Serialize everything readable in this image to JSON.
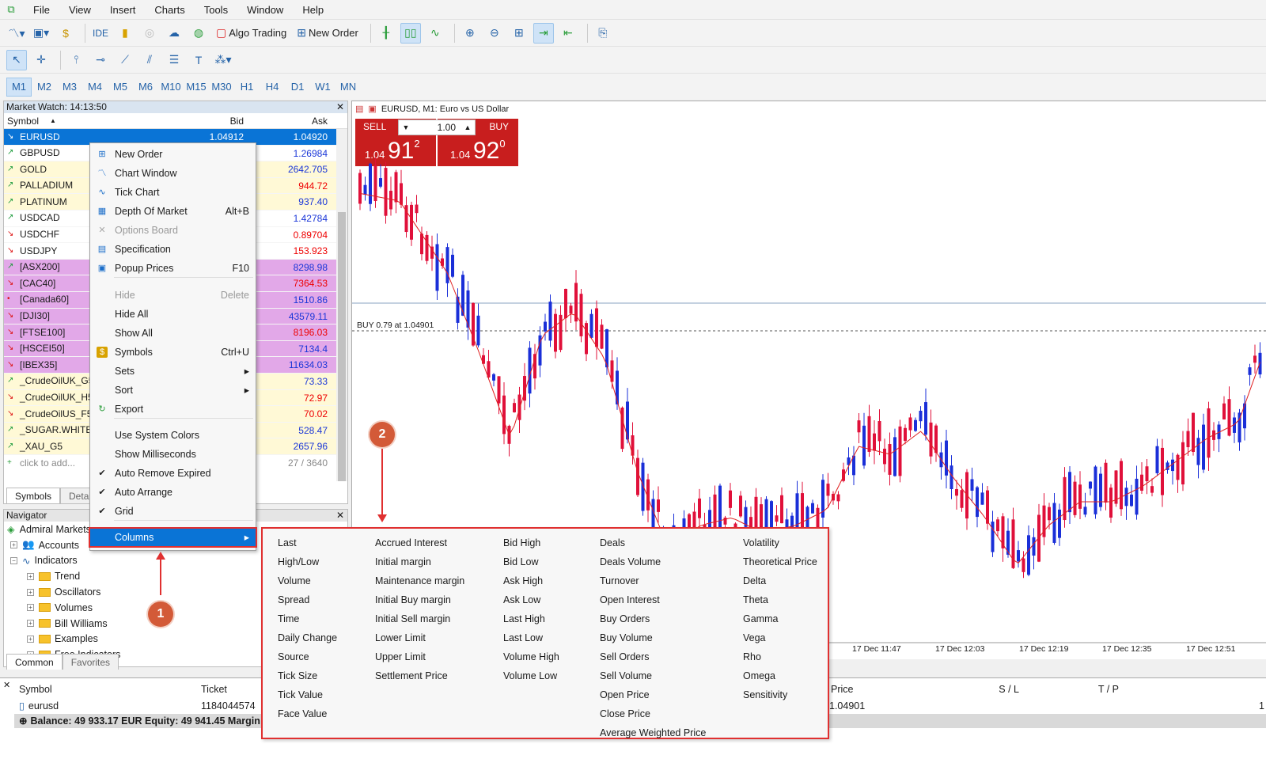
{
  "menu": [
    "File",
    "View",
    "Insert",
    "Charts",
    "Tools",
    "Window",
    "Help"
  ],
  "toolbar": {
    "ide": "IDE",
    "algo_trading": "Algo Trading",
    "new_order": "New Order"
  },
  "timeframes": [
    "M1",
    "M2",
    "M3",
    "M4",
    "M5",
    "M6",
    "M10",
    "M15",
    "M30",
    "H1",
    "H4",
    "D1",
    "W1",
    "MN"
  ],
  "market_watch": {
    "title": "Market Watch: 14:13:50",
    "col_symbol": "Symbol",
    "col_bid": "Bid",
    "col_ask": "Ask",
    "rows": [
      {
        "s": "EURUSD",
        "b": "1.04912",
        "a": "1.04920"
      },
      {
        "s": "GBPUSD",
        "b": "",
        "a": "1.26984"
      },
      {
        "s": "GOLD",
        "b": "",
        "a": "2642.705"
      },
      {
        "s": "PALLADIUM",
        "b": "",
        "a": "944.72"
      },
      {
        "s": "PLATINUM",
        "b": "",
        "a": "937.40"
      },
      {
        "s": "USDCAD",
        "b": "",
        "a": "1.42784"
      },
      {
        "s": "USDCHF",
        "b": "",
        "a": "0.89704"
      },
      {
        "s": "USDJPY",
        "b": "",
        "a": "153.923"
      },
      {
        "s": "[ASX200]",
        "b": "",
        "a": "8298.98"
      },
      {
        "s": "[CAC40]",
        "b": "",
        "a": "7364.53"
      },
      {
        "s": "[Canada60]",
        "b": "",
        "a": "1510.86"
      },
      {
        "s": "[DJI30]",
        "b": "",
        "a": "43579.11"
      },
      {
        "s": "[FTSE100]",
        "b": "",
        "a": "8196.03"
      },
      {
        "s": "[HSCEI50]",
        "b": "",
        "a": "7134.4"
      },
      {
        "s": "[IBEX35]",
        "b": "",
        "a": "11634.03"
      },
      {
        "s": "_CrudeOilUK_G5",
        "b": "",
        "a": "73.33"
      },
      {
        "s": "_CrudeOilUK_H5",
        "b": "",
        "a": "72.97"
      },
      {
        "s": "_CrudeOilUS_F5",
        "b": "",
        "a": "70.02"
      },
      {
        "s": "_SUGAR.WHITE_",
        "b": "",
        "a": "528.47"
      },
      {
        "s": "_XAU_G5",
        "b": "",
        "a": "2657.96"
      }
    ],
    "add": "click to add...",
    "count": "27 / 3640",
    "tab_symbols": "Symbols",
    "tab_details": "Details"
  },
  "navigator": {
    "title": "Navigator",
    "root": "Admiral Markets",
    "accounts": "Accounts",
    "indicators": "Indicators",
    "folders": [
      "Trend",
      "Oscillators",
      "Volumes",
      "Bill Williams",
      "Examples",
      "Free Indicators"
    ],
    "tab_common": "Common",
    "tab_favorites": "Favorites"
  },
  "chart": {
    "title": "EURUSD, M1:  Euro vs US Dollar",
    "sell": "SELL",
    "buy": "BUY",
    "volume": "1.00",
    "sell_pre": "1.04",
    "sell_big": "91",
    "sell_sup": "2",
    "buy_pre": "1.04",
    "buy_big": "92",
    "buy_sup": "0",
    "order_line": "BUY 0.79 at 1.04901",
    "time_labels": [
      "17 Dec 11:47",
      "17 Dec 12:03",
      "17 Dec 12:19",
      "17 Dec 12:35",
      "17 Dec 12:51"
    ]
  },
  "context_menu": {
    "items": [
      {
        "l": "New Order",
        "s": ""
      },
      {
        "l": "Chart Window",
        "s": ""
      },
      {
        "l": "Tick Chart",
        "s": ""
      },
      {
        "l": "Depth Of Market",
        "s": "Alt+B"
      },
      {
        "l": "Options Board",
        "s": ""
      },
      {
        "l": "Specification",
        "s": ""
      },
      {
        "l": "Popup Prices",
        "s": "F10"
      },
      {
        "l": "Hide",
        "s": "Delete"
      },
      {
        "l": "Hide All",
        "s": ""
      },
      {
        "l": "Show All",
        "s": ""
      },
      {
        "l": "Symbols",
        "s": "Ctrl+U"
      },
      {
        "l": "Sets",
        "s": ""
      },
      {
        "l": "Sort",
        "s": ""
      },
      {
        "l": "Export",
        "s": ""
      },
      {
        "l": "Use System Colors",
        "s": ""
      },
      {
        "l": "Show Milliseconds",
        "s": ""
      },
      {
        "l": "Auto Remove Expired",
        "s": ""
      },
      {
        "l": "Auto Arrange",
        "s": ""
      },
      {
        "l": "Grid",
        "s": ""
      },
      {
        "l": "Columns",
        "s": ""
      }
    ]
  },
  "columns_submenu": [
    [
      "Last",
      "High/Low",
      "Volume",
      "Spread",
      "Time",
      "Daily Change",
      "Source",
      "Tick Size",
      "Tick Value",
      "Face Value"
    ],
    [
      "Accrued Interest",
      "Initial margin",
      "Maintenance margin",
      "Initial Buy margin",
      "Initial Sell margin",
      "Lower Limit",
      "Upper Limit",
      "Settlement Price"
    ],
    [
      "Bid High",
      "Bid Low",
      "Ask High",
      "Ask Low",
      "Last High",
      "Last Low",
      "Volume High",
      "Volume Low"
    ],
    [
      "Deals",
      "Deals Volume",
      "Turnover",
      "Open Interest",
      "Buy Orders",
      "Buy Volume",
      "Sell Orders",
      "Sell Volume",
      "Open Price",
      "Close Price",
      "Average Weighted Price"
    ],
    [
      "Volatility",
      "Theoretical Price",
      "Delta",
      "Theta",
      "Gamma",
      "Vega",
      "Rho",
      "Omega",
      "Sensitivity"
    ]
  ],
  "toolbox": {
    "col_symbol": "Symbol",
    "col_ticket": "Ticket",
    "col_price": "Price",
    "col_sl": "S / L",
    "col_tp": "T / P",
    "row_symbol": "eurusd",
    "row_ticket": "1184044574",
    "row_price": "1.04901",
    "row_right": "1",
    "balance": "Balance: 49 933.17 EUR  Equity: 49 941.45  Margin"
  },
  "badges": {
    "one": "1",
    "two": "2"
  }
}
